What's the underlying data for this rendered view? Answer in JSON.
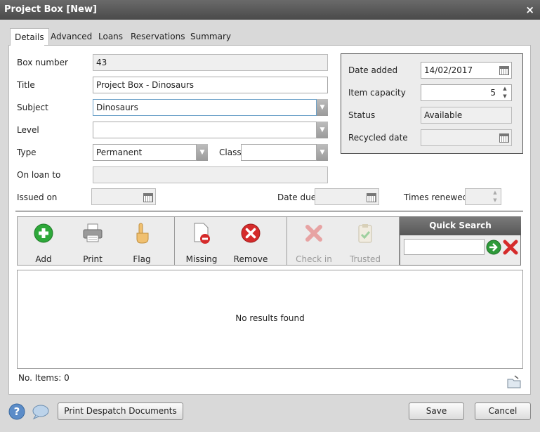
{
  "window": {
    "title": "Project Box [New]",
    "close": "×"
  },
  "tabs": [
    "Details",
    "Advanced",
    "Loans",
    "Reservations",
    "Summary"
  ],
  "form": {
    "box_number_label": "Box number",
    "box_number": "43",
    "title_label": "Title",
    "title": "Project Box - Dinosaurs",
    "subject_label": "Subject",
    "subject": "Dinosaurs",
    "level_label": "Level",
    "level": "",
    "type_label": "Type",
    "type": "Permanent",
    "class_label": "Class",
    "class": "",
    "on_loan_label": "On loan to",
    "on_loan": "",
    "issued_on_label": "Issued on",
    "issued_on": "",
    "date_due_label": "Date due",
    "date_due": "",
    "times_renewed_label": "Times renewed",
    "times_renewed": ""
  },
  "side": {
    "date_added_label": "Date added",
    "date_added": "14/02/2017",
    "item_capacity_label": "Item capacity",
    "item_capacity": "5",
    "status_label": "Status",
    "status": "Available",
    "recycled_label": "Recycled date",
    "recycled": ""
  },
  "toolbar": {
    "add": "Add",
    "print": "Print",
    "flag": "Flag",
    "missing": "Missing",
    "remove": "Remove",
    "checkin": "Check in",
    "trusted": "Trusted"
  },
  "quick_search": {
    "title": "Quick Search",
    "value": ""
  },
  "results": {
    "empty": "No results found",
    "count": "No. Items: 0"
  },
  "footer": {
    "print_despatch": "Print Despatch Documents",
    "save": "Save",
    "cancel": "Cancel"
  },
  "colors": {
    "titlebar": "#555555",
    "add_green": "#2ea83a",
    "remove_red": "#d52b2b",
    "search_go": "#2e9a3a"
  }
}
